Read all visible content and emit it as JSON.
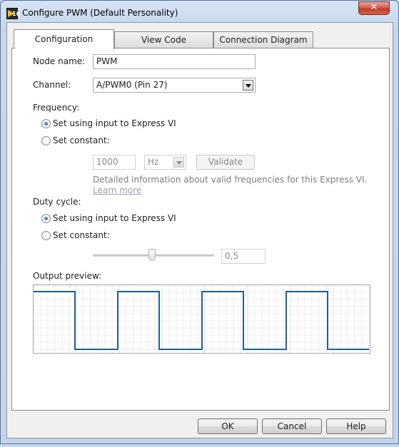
{
  "window": {
    "title": "Configure PWM (Default Personality)",
    "close_glyph": "✕"
  },
  "tabs": [
    "Configuration",
    "View Code",
    "Connection Diagram"
  ],
  "node_name": {
    "label": "Node name:",
    "value": "PWM"
  },
  "channel": {
    "label": "Channel:",
    "value": "A/PWM0 (Pin 27)"
  },
  "frequency": {
    "label": "Frequency:",
    "option_input": "Set using input to Express VI",
    "option_constant": "Set constant:",
    "selected": "input",
    "value": "1000",
    "unit": "Hz",
    "validate_label": "Validate",
    "info": "Detailed information about valid frequencies for this Express VI.",
    "learn_more": "Learn more"
  },
  "duty_cycle": {
    "label": "Duty cycle:",
    "option_input": "Set using input to Express VI",
    "option_constant": "Set constant:",
    "selected": "input",
    "value": "0,5",
    "slider_fraction": 0.5
  },
  "preview": {
    "label": "Output preview:",
    "line_color": "#1f5f9f",
    "high_segments": [
      [
        0,
        58
      ],
      [
        118,
        176
      ],
      [
        236,
        294
      ],
      [
        354,
        412
      ]
    ],
    "period_width": 470
  },
  "buttons": {
    "ok": "OK",
    "cancel": "Cancel",
    "help": "Help"
  }
}
